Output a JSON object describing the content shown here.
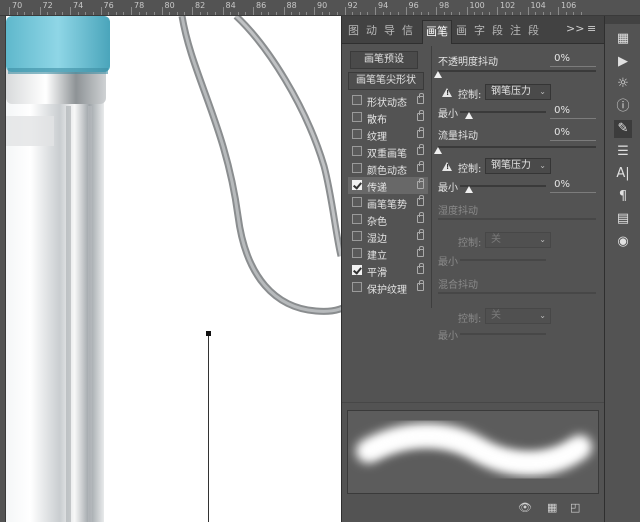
{
  "ruler": {
    "numbers": [
      "70",
      "72",
      "74",
      "76",
      "78",
      "80",
      "82",
      "84",
      "86",
      "88",
      "90",
      "92",
      "94",
      "96",
      "98",
      "100",
      "102",
      "104",
      "106"
    ]
  },
  "tabs": [
    {
      "label": "图",
      "icon": "tab-icon"
    },
    {
      "label": "动",
      "icon": "tab-icon"
    },
    {
      "label": "导",
      "icon": "tab-icon"
    },
    {
      "label": "信",
      "icon": "tab-icon"
    },
    {
      "label": "画笔",
      "active": true
    },
    {
      "label": "画",
      "icon": "tab-icon"
    },
    {
      "label": "字",
      "icon": "tab-icon"
    },
    {
      "label": "段",
      "icon": "tab-icon"
    },
    {
      "label": "注",
      "icon": "tab-icon"
    },
    {
      "label": "段",
      "icon": "tab-icon"
    }
  ],
  "tab_menu": {
    "collapse": ">>",
    "menu": "≡"
  },
  "preset_button": "画笔预设",
  "options_header": "画笔笔尖形状",
  "options": [
    {
      "label": "形状动态",
      "checked": false
    },
    {
      "label": "散布",
      "checked": false
    },
    {
      "label": "纹理",
      "checked": false
    },
    {
      "label": "双重画笔",
      "checked": false
    },
    {
      "label": "颜色动态",
      "checked": false
    },
    {
      "label": "传递",
      "checked": true,
      "selected": true
    },
    {
      "label": "画笔笔势",
      "checked": false
    },
    {
      "label": "杂色",
      "checked": false
    },
    {
      "label": "湿边",
      "checked": false
    },
    {
      "label": "建立",
      "checked": false
    },
    {
      "label": "平滑",
      "checked": true
    },
    {
      "label": "保护纹理",
      "checked": false
    }
  ],
  "settings": {
    "opacity_jitter": {
      "label": "不透明度抖动",
      "value": "0%"
    },
    "control1": {
      "label": "控制:",
      "value": "钢笔压力"
    },
    "min1": {
      "label": "最小",
      "value": "0%"
    },
    "flow_jitter": {
      "label": "流量抖动",
      "value": "0%"
    },
    "control2": {
      "label": "控制:",
      "value": "钢笔压力"
    },
    "min2": {
      "label": "最小",
      "value": "0%"
    },
    "wetness_jitter": {
      "label": "湿度抖动"
    },
    "control3": {
      "label": "控制:",
      "value": "关"
    },
    "min3": {
      "label": "最小"
    },
    "mix_jitter": {
      "label": "混合抖动"
    },
    "control4": {
      "label": "控制:",
      "value": "关"
    },
    "min4": {
      "label": "最小"
    }
  },
  "bottom_icons": [
    "eye-icon",
    "grid-icon",
    "new-icon"
  ],
  "tools": [
    "swatch-icon",
    "play-icon",
    "sun-icon",
    "info-icon",
    "brush-icon",
    "sliders-icon",
    "text-icon",
    "paragraph-icon",
    "doc-icon",
    "layers-icon"
  ],
  "tool_glyphs": [
    "▦",
    "▶",
    "☼",
    "ⓘ",
    "✎",
    "☰",
    "A|",
    "¶",
    "▤",
    "◉"
  ]
}
